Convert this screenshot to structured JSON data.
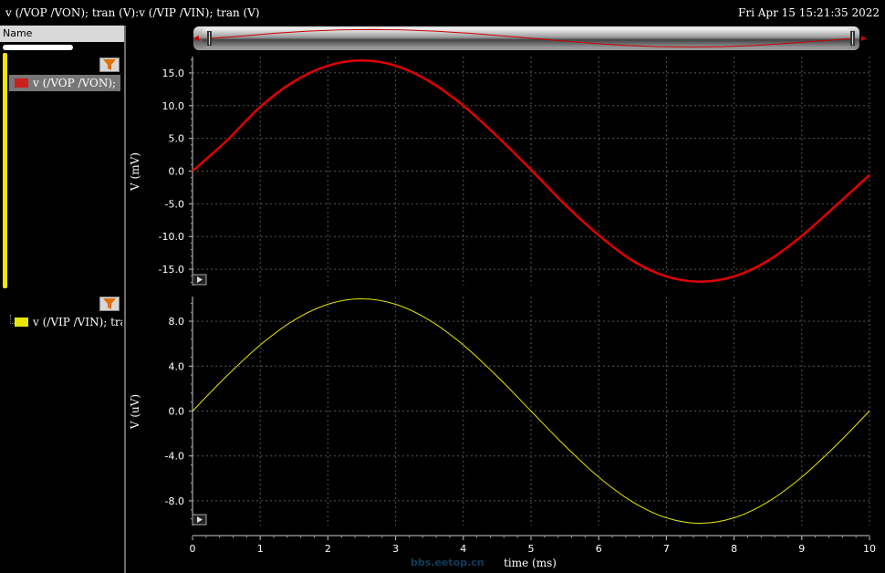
{
  "window": {
    "title": "v (/VOP /VON); tran (V):v (/VIP /VIN); tran (V)",
    "date": "Fri Apr 15 15:21:35 2022"
  },
  "sidebar": {
    "header": "Name",
    "signals": [
      {
        "label": "v (/VOP /VON);",
        "color": "#cc1f1f",
        "selected": true
      },
      {
        "label": "v (/VIP /VIN); tra",
        "color": "#e6e600",
        "selected": false
      }
    ],
    "filter_icon": "filter-icon"
  },
  "watermark": "bbs.eetop.cn",
  "chart_data": [
    {
      "type": "line",
      "series": [
        {
          "name": "v (/VOP /VON);",
          "color": "#e00000",
          "x": [
            0,
            0.5,
            1,
            1.5,
            2,
            2.5,
            3,
            3.5,
            4,
            4.5,
            5,
            5.5,
            6,
            6.5,
            7,
            7.5,
            8,
            8.5,
            9,
            9.5,
            10
          ],
          "values": [
            0,
            4.6,
            9.8,
            13.7,
            16.1,
            16.9,
            16.1,
            13.7,
            10,
            5.3,
            0.2,
            -5.1,
            -9.8,
            -13.7,
            -16.1,
            -16.9,
            -16.1,
            -13.7,
            -9.9,
            -5.3,
            -0.6
          ]
        }
      ],
      "ylabel": "V (mV)",
      "ylim": [
        -17.5,
        17.5
      ],
      "yticks": [
        "15.0",
        "10.0",
        "5.0",
        "0.0",
        "-5.0",
        "-10.0",
        "-15.0"
      ],
      "ytick_values": [
        15,
        10,
        5,
        0,
        -5,
        -10,
        -15
      ],
      "grid": true
    },
    {
      "type": "line",
      "series": [
        {
          "name": "v (/VIP /VIN); tra",
          "color": "#e6e600",
          "x": [
            0,
            0.5,
            1,
            1.5,
            2,
            2.5,
            3,
            3.5,
            4,
            4.5,
            5,
            5.5,
            6,
            6.5,
            7,
            7.5,
            8,
            8.5,
            9,
            9.5,
            10
          ],
          "values": [
            0,
            3.09,
            5.88,
            8.09,
            9.51,
            10,
            9.51,
            8.09,
            5.88,
            3.09,
            0,
            -3.09,
            -5.88,
            -8.09,
            -9.51,
            -10,
            -9.51,
            -8.09,
            -5.88,
            -3.09,
            0
          ]
        }
      ],
      "ylabel": "V (uV)",
      "ylim": [
        -10.2,
        10.2
      ],
      "yticks": [
        "8.0",
        "4.0",
        "0.0",
        "-4.0",
        "-8.0"
      ],
      "ytick_values": [
        8,
        4,
        0,
        -4,
        -8
      ],
      "grid": true
    }
  ],
  "xaxis": {
    "label": "time (ms)",
    "xlim": [
      0,
      10
    ],
    "ticks": [
      "0",
      "1",
      "2",
      "3",
      "4",
      "5",
      "6",
      "7",
      "8",
      "9",
      "10"
    ]
  }
}
